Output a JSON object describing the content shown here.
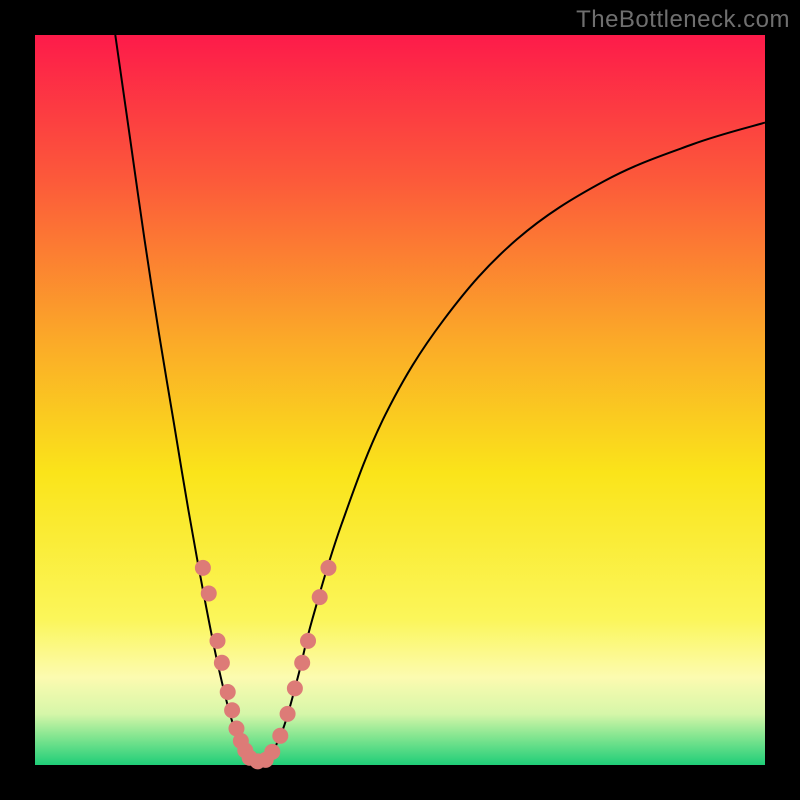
{
  "watermark": "TheBottleneck.com",
  "gradient": {
    "stops": [
      {
        "pct": 0,
        "color": "#fd1b4a"
      },
      {
        "pct": 20,
        "color": "#fc5a3a"
      },
      {
        "pct": 42,
        "color": "#fbaa28"
      },
      {
        "pct": 60,
        "color": "#fae41a"
      },
      {
        "pct": 80,
        "color": "#fbf65a"
      },
      {
        "pct": 88,
        "color": "#fcfbb0"
      },
      {
        "pct": 93,
        "color": "#d6f6a9"
      },
      {
        "pct": 96,
        "color": "#86e691"
      },
      {
        "pct": 100,
        "color": "#1fce78"
      }
    ]
  },
  "colors": {
    "curve": "#000000",
    "marker": "#dd7b77",
    "frame": "#000000"
  },
  "chart_data": {
    "type": "line",
    "title": "",
    "xlabel": "",
    "ylabel": "",
    "xlim": [
      0,
      100
    ],
    "ylim": [
      0,
      100
    ],
    "series": [
      {
        "name": "left-curve",
        "x": [
          11,
          13,
          15,
          17,
          19,
          21,
          23,
          25,
          27,
          29,
          30.5
        ],
        "y": [
          100,
          86,
          72,
          59,
          47,
          35,
          24,
          14,
          6,
          1,
          0
        ]
      },
      {
        "name": "right-curve",
        "x": [
          30.5,
          32,
          34,
          36,
          38,
          42,
          48,
          56,
          66,
          78,
          90,
          100
        ],
        "y": [
          0,
          1,
          5,
          12,
          20,
          33,
          48,
          61,
          72,
          80,
          85,
          88
        ]
      }
    ],
    "markers": {
      "name": "highlight-points",
      "points": [
        {
          "x": 23.0,
          "y": 27.0
        },
        {
          "x": 23.8,
          "y": 23.5
        },
        {
          "x": 25.0,
          "y": 17.0
        },
        {
          "x": 25.6,
          "y": 14.0
        },
        {
          "x": 26.4,
          "y": 10.0
        },
        {
          "x": 27.0,
          "y": 7.5
        },
        {
          "x": 27.6,
          "y": 5.0
        },
        {
          "x": 28.2,
          "y": 3.3
        },
        {
          "x": 28.8,
          "y": 2.0
        },
        {
          "x": 29.4,
          "y": 1.0
        },
        {
          "x": 30.5,
          "y": 0.5
        },
        {
          "x": 31.6,
          "y": 0.7
        },
        {
          "x": 32.5,
          "y": 1.8
        },
        {
          "x": 33.6,
          "y": 4.0
        },
        {
          "x": 34.6,
          "y": 7.0
        },
        {
          "x": 35.6,
          "y": 10.5
        },
        {
          "x": 36.6,
          "y": 14.0
        },
        {
          "x": 37.4,
          "y": 17.0
        },
        {
          "x": 39.0,
          "y": 23.0
        },
        {
          "x": 40.2,
          "y": 27.0
        }
      ]
    }
  }
}
